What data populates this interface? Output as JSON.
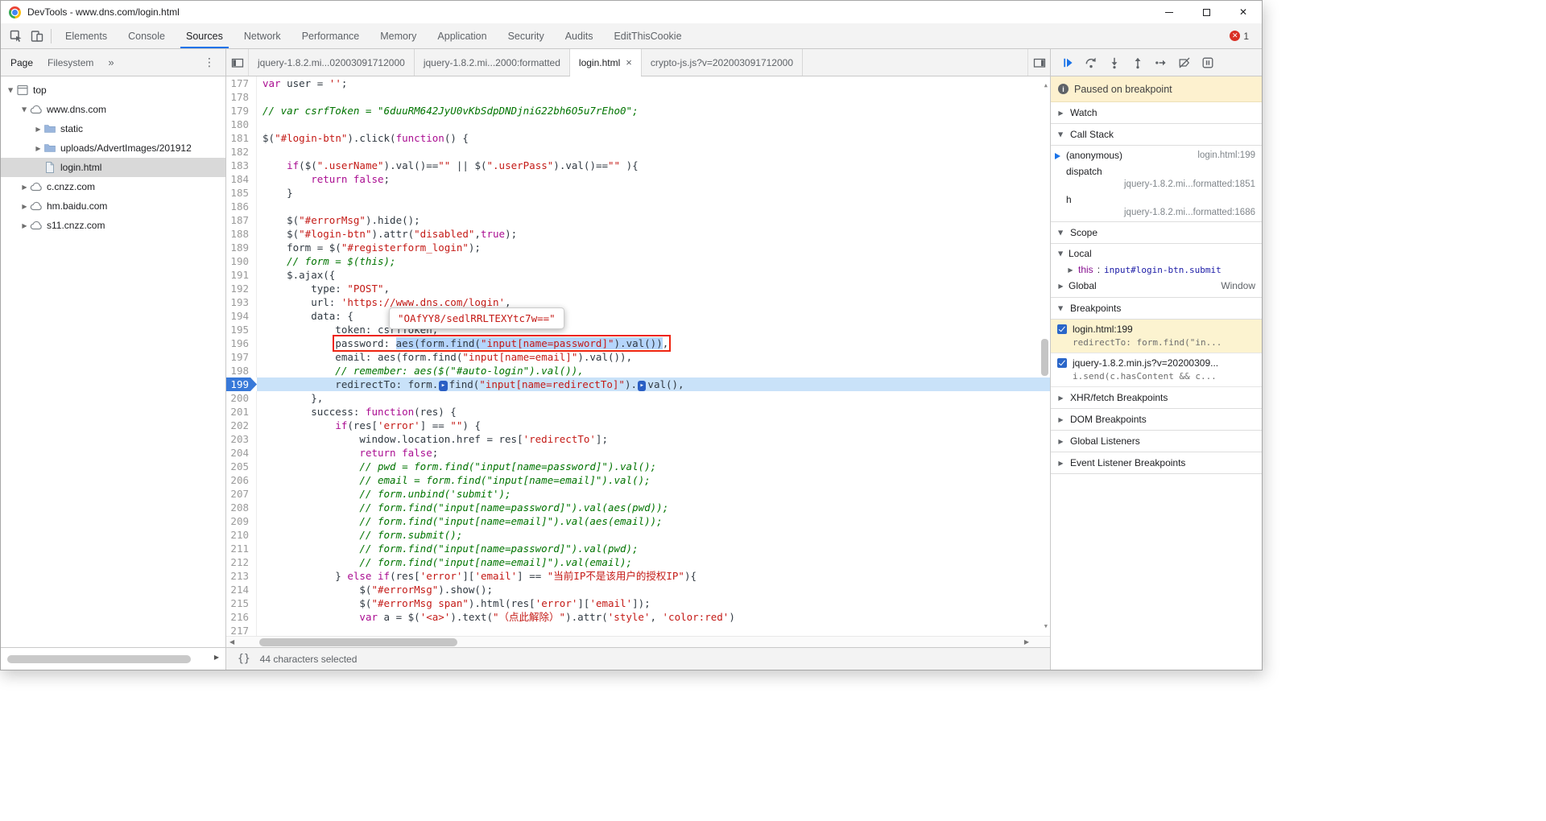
{
  "window": {
    "title": "DevTools - www.dns.com/login.html"
  },
  "colors": {
    "accent_blue": "#1a73e8",
    "error_red": "#d93025",
    "annotation_red": "#ee2410",
    "selection_blue": "#b5d5fc",
    "execution_line_blue": "#c9e2f9",
    "paused_banner_yellow": "#fdf1cf",
    "active_breakpoint_yellow": "#fcf3d0",
    "keyword_purple": "#aa0d91",
    "string_red": "#c41a16",
    "comment_green": "#007400"
  },
  "toolbar": {
    "tabs": [
      {
        "label": "Elements"
      },
      {
        "label": "Console"
      },
      {
        "label": "Sources",
        "active": true
      },
      {
        "label": "Network"
      },
      {
        "label": "Performance"
      },
      {
        "label": "Memory"
      },
      {
        "label": "Application"
      },
      {
        "label": "Security"
      },
      {
        "label": "Audits"
      },
      {
        "label": "EditThisCookie"
      }
    ],
    "error_count": "1"
  },
  "sidebar": {
    "tabs": [
      {
        "label": "Page",
        "active": true
      },
      {
        "label": "Filesystem"
      }
    ],
    "tree": [
      {
        "label": "top",
        "icon": "frame",
        "depth": 0,
        "expandable": true,
        "expanded": true
      },
      {
        "label": "www.dns.com",
        "icon": "cloud",
        "depth": 1,
        "expandable": true,
        "expanded": true
      },
      {
        "label": "static",
        "icon": "folder",
        "depth": 2,
        "expandable": true,
        "expanded": false
      },
      {
        "label": "uploads/AdvertImages/201912",
        "icon": "folder",
        "depth": 2,
        "expandable": true,
        "expanded": false
      },
      {
        "label": "login.html",
        "icon": "file",
        "depth": 2,
        "expandable": false,
        "selected": true
      },
      {
        "label": "c.cnzz.com",
        "icon": "cloud",
        "depth": 1,
        "expandable": true,
        "expanded": false
      },
      {
        "label": "hm.baidu.com",
        "icon": "cloud",
        "depth": 1,
        "expandable": true,
        "expanded": false
      },
      {
        "label": "s11.cnzz.com",
        "icon": "cloud",
        "depth": 1,
        "expandable": true,
        "expanded": false
      }
    ]
  },
  "editor": {
    "tabs": [
      {
        "label": "jquery-1.8.2.mi...02003091712000"
      },
      {
        "label": "jquery-1.8.2.mi...2000:formatted"
      },
      {
        "label": "login.html",
        "active": true,
        "closable": true
      },
      {
        "label": "crypto-js.js?v=202003091712000"
      }
    ],
    "tooltip": "\"OAfYY8/sedlRRLTEXYtc7w==\"",
    "pretty_print_label": "{}",
    "status": "44 characters selected",
    "lines": [
      {
        "n": 177,
        "t": [
          [
            "k",
            "var"
          ],
          [
            "p",
            " user = "
          ],
          [
            "s",
            "''"
          ],
          [
            "p",
            ";"
          ]
        ]
      },
      {
        "n": 178,
        "t": []
      },
      {
        "n": 179,
        "t": [
          [
            "c",
            "// var csrfToken = \"6duuRM642JyU0vKbSdpDNDjniG22bh6O5u7rEho0\";"
          ]
        ]
      },
      {
        "n": 180,
        "t": []
      },
      {
        "n": 181,
        "t": [
          [
            "p",
            "$("
          ],
          [
            "s",
            "\"#login-btn\""
          ],
          [
            "p",
            ").click("
          ],
          [
            "k",
            "function"
          ],
          [
            "p",
            "() {"
          ]
        ]
      },
      {
        "n": 182,
        "t": []
      },
      {
        "n": 183,
        "t": [
          [
            "p",
            "    "
          ],
          [
            "k",
            "if"
          ],
          [
            "p",
            "($("
          ],
          [
            "s",
            "\".userName\""
          ],
          [
            "p",
            ").val()=="
          ],
          [
            "s",
            "\"\""
          ],
          [
            "p",
            " || $("
          ],
          [
            "s",
            "\".userPass\""
          ],
          [
            "p",
            ").val()=="
          ],
          [
            "s",
            "\"\""
          ],
          [
            "p",
            " ){"
          ]
        ]
      },
      {
        "n": 184,
        "t": [
          [
            "p",
            "        "
          ],
          [
            "k",
            "return"
          ],
          [
            "p",
            " "
          ],
          [
            "k",
            "false"
          ],
          [
            "p",
            ";"
          ]
        ]
      },
      {
        "n": 185,
        "t": [
          [
            "p",
            "    }"
          ]
        ]
      },
      {
        "n": 186,
        "t": []
      },
      {
        "n": 187,
        "t": [
          [
            "p",
            "    $("
          ],
          [
            "s",
            "\"#errorMsg\""
          ],
          [
            "p",
            ").hide();"
          ]
        ]
      },
      {
        "n": 188,
        "t": [
          [
            "p",
            "    $("
          ],
          [
            "s",
            "\"#login-btn\""
          ],
          [
            "p",
            ").attr("
          ],
          [
            "s",
            "\"disabled\""
          ],
          [
            "p",
            ","
          ],
          [
            "k",
            "true"
          ],
          [
            "p",
            ");"
          ]
        ]
      },
      {
        "n": 189,
        "t": [
          [
            "p",
            "    form = $("
          ],
          [
            "s",
            "\"#registerform_login\""
          ],
          [
            "p",
            ");"
          ]
        ]
      },
      {
        "n": 190,
        "t": [
          [
            "c",
            "    // form = $(this);"
          ]
        ]
      },
      {
        "n": 191,
        "t": [
          [
            "p",
            "    $.ajax({"
          ]
        ]
      },
      {
        "n": 192,
        "t": [
          [
            "p",
            "        type: "
          ],
          [
            "s",
            "\"POST\""
          ],
          [
            "p",
            ","
          ]
        ]
      },
      {
        "n": 193,
        "t": [
          [
            "p",
            "        url: "
          ],
          [
            "s",
            "'https://www.dns.com/login'"
          ],
          [
            "p",
            ","
          ]
        ]
      },
      {
        "n": 194,
        "t": [
          [
            "p",
            "        data: {"
          ]
        ]
      },
      {
        "n": 195,
        "t": [
          [
            "p",
            "            token: csrfToken,"
          ]
        ]
      },
      {
        "n": 196,
        "t": [
          [
            "p",
            "            "
          ],
          [
            "box",
            [
              [
                "p",
                "password: "
              ],
              [
                "sel",
                [
                  [
                    "p",
                    "aes(form.find("
                  ],
                  [
                    "s",
                    "\"input[name=password]\""
                  ],
                  [
                    "p",
                    ").val())"
                  ]
                ]
              ],
              [
                "p",
                ","
              ]
            ]
          ]
        ]
      },
      {
        "n": 197,
        "t": [
          [
            "p",
            "            email: aes(form.find("
          ],
          [
            "s",
            "\"input[name=email]\""
          ],
          [
            "p",
            ").val()),"
          ]
        ]
      },
      {
        "n": 198,
        "t": [
          [
            "c",
            "            // remember: aes($(\"#auto-login\").val()),"
          ]
        ]
      },
      {
        "n": 199,
        "exec": true,
        "t": [
          [
            "p",
            "            redirectTo: form."
          ],
          [
            "m",
            "▸"
          ],
          [
            "p",
            "find("
          ],
          [
            "s",
            "\"input[name=redirectTo]\""
          ],
          [
            "p",
            ")."
          ],
          [
            "m",
            "▸"
          ],
          [
            "p",
            "val(),"
          ]
        ]
      },
      {
        "n": 200,
        "t": [
          [
            "p",
            "        },"
          ]
        ]
      },
      {
        "n": 201,
        "t": [
          [
            "p",
            "        success: "
          ],
          [
            "k",
            "function"
          ],
          [
            "p",
            "(res) {"
          ]
        ]
      },
      {
        "n": 202,
        "t": [
          [
            "p",
            "            "
          ],
          [
            "k",
            "if"
          ],
          [
            "p",
            "(res["
          ],
          [
            "s",
            "'error'"
          ],
          [
            "p",
            "] == "
          ],
          [
            "s",
            "\"\""
          ],
          [
            "p",
            ") {"
          ]
        ]
      },
      {
        "n": 203,
        "t": [
          [
            "p",
            "                window.location.href = res["
          ],
          [
            "s",
            "'redirectTo'"
          ],
          [
            "p",
            "];"
          ]
        ]
      },
      {
        "n": 204,
        "t": [
          [
            "p",
            "                "
          ],
          [
            "k",
            "return"
          ],
          [
            "p",
            " "
          ],
          [
            "k",
            "false"
          ],
          [
            "p",
            ";"
          ]
        ]
      },
      {
        "n": 205,
        "t": [
          [
            "c",
            "                // pwd = form.find(\"input[name=password]\").val();"
          ]
        ]
      },
      {
        "n": 206,
        "t": [
          [
            "c",
            "                // email = form.find(\"input[name=email]\").val();"
          ]
        ]
      },
      {
        "n": 207,
        "t": [
          [
            "c",
            "                // form.unbind('submit');"
          ]
        ]
      },
      {
        "n": 208,
        "t": [
          [
            "c",
            "                // form.find(\"input[name=password]\").val(aes(pwd));"
          ]
        ]
      },
      {
        "n": 209,
        "t": [
          [
            "c",
            "                // form.find(\"input[name=email]\").val(aes(email));"
          ]
        ]
      },
      {
        "n": 210,
        "t": [
          [
            "c",
            "                // form.submit();"
          ]
        ]
      },
      {
        "n": 211,
        "t": [
          [
            "c",
            "                // form.find(\"input[name=password]\").val(pwd);"
          ]
        ]
      },
      {
        "n": 212,
        "t": [
          [
            "c",
            "                // form.find(\"input[name=email]\").val(email);"
          ]
        ]
      },
      {
        "n": 213,
        "t": [
          [
            "p",
            "            } "
          ],
          [
            "k",
            "else"
          ],
          [
            "p",
            " "
          ],
          [
            "k",
            "if"
          ],
          [
            "p",
            "(res["
          ],
          [
            "s",
            "'error'"
          ],
          [
            "p",
            "]["
          ],
          [
            "s",
            "'email'"
          ],
          [
            "p",
            "] == "
          ],
          [
            "s",
            "\"当前IP不是该用户的授权IP\""
          ],
          [
            "p",
            "){"
          ]
        ]
      },
      {
        "n": 214,
        "t": [
          [
            "p",
            "                $("
          ],
          [
            "s",
            "\"#errorMsg\""
          ],
          [
            "p",
            ").show();"
          ]
        ]
      },
      {
        "n": 215,
        "t": [
          [
            "p",
            "                $("
          ],
          [
            "s",
            "\"#errorMsg span\""
          ],
          [
            "p",
            ").html(res["
          ],
          [
            "s",
            "'error'"
          ],
          [
            "p",
            "]["
          ],
          [
            "s",
            "'email'"
          ],
          [
            "p",
            "]);"
          ]
        ]
      },
      {
        "n": 216,
        "t": [
          [
            "p",
            "                "
          ],
          [
            "k",
            "var"
          ],
          [
            "p",
            " a = $("
          ],
          [
            "s",
            "'<a>'"
          ],
          [
            "p",
            ").text("
          ],
          [
            "s",
            "\"（点此解除）\""
          ],
          [
            "p",
            ").attr("
          ],
          [
            "s",
            "'style'"
          ],
          [
            "p",
            ", "
          ],
          [
            "s",
            "'color:red'"
          ],
          [
            "p",
            ")"
          ]
        ]
      },
      {
        "n": 217,
        "t": []
      }
    ]
  },
  "debugger": {
    "toolbar": [
      "resume",
      "step-over",
      "step-into",
      "step-out",
      "step",
      "deactivate-breakpoints",
      "pause-on-exceptions"
    ],
    "paused_message": "Paused on breakpoint",
    "watch_label": "Watch",
    "call_stack_label": "Call Stack",
    "scope_label": "Scope",
    "breakpoints_label": "Breakpoints",
    "call_stack": [
      {
        "name": "(anonymous)",
        "location": "login.html:199",
        "active": true
      },
      {
        "name": "dispatch",
        "location": "jquery-1.8.2.mi...formatted:1851",
        "two_line": true
      },
      {
        "name": "h",
        "location": "jquery-1.8.2.mi...formatted:1686",
        "two_line": true
      }
    ],
    "scope": {
      "local_label": "Local",
      "this_name": "this",
      "this_value": "input#login-btn.submit",
      "global_label": "Global",
      "global_value": "Window"
    },
    "breakpoints": [
      {
        "title": "login.html:199",
        "snippet": "redirectTo: form.find(\"in...",
        "checked": true,
        "active": true
      },
      {
        "title": "jquery-1.8.2.min.js?v=20200309...",
        "snippet": "i.send(c.hasContent && c...",
        "checked": true
      }
    ],
    "more_sections": [
      "XHR/fetch Breakpoints",
      "DOM Breakpoints",
      "Global Listeners",
      "Event Listener Breakpoints"
    ]
  }
}
